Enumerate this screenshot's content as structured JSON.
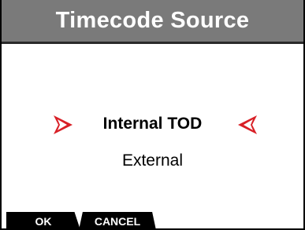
{
  "header": {
    "title": "Timecode Source"
  },
  "options": [
    {
      "label": "Internal TOD",
      "selected": true
    },
    {
      "label": "External",
      "selected": false
    }
  ],
  "softkeys": {
    "ok_label": "OK",
    "cancel_label": "CANCEL"
  },
  "colors": {
    "header_bg": "#7a7a7a",
    "selection_chevron": "#d81f26",
    "softkey_bg": "#000000"
  },
  "icons": {
    "selection_left": "chevron-right-icon",
    "selection_right": "chevron-left-icon"
  }
}
